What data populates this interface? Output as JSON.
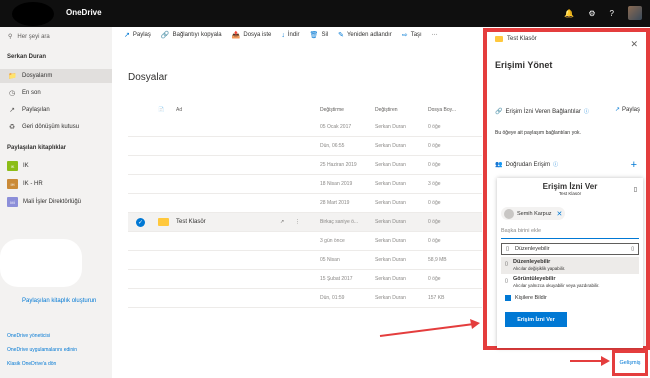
{
  "app": {
    "title": "OneDrive",
    "brand_color": "#0078d4",
    "highlight_color": "#e43d3d"
  },
  "topbar": {
    "icons": [
      "bell-icon",
      "gear-icon",
      "help-icon"
    ]
  },
  "nav": {
    "search_placeholder": "Her şeyi ara",
    "user_name": "Serkan Duran",
    "items": [
      {
        "label": "Dosyalarım",
        "icon": "folder-icon",
        "active": true
      },
      {
        "label": "En son",
        "icon": "clock-icon"
      },
      {
        "label": "Paylaşılan",
        "icon": "share-icon"
      },
      {
        "label": "Geri dönüşüm kutusu",
        "icon": "recycle-icon"
      }
    ],
    "shared_libs_heading": "Paylaşılan kitaplıklar",
    "libraries": [
      {
        "label": "IK",
        "color": "#8cbd18"
      },
      {
        "label": "IK - HR",
        "color": "#ca8a37"
      },
      {
        "label": "Mali İşler Direktörlüğü",
        "color": "#8c8fd9"
      }
    ],
    "create_library": "Paylaşılan kitaplık oluşturun",
    "footer": [
      "OneDrive yöneticisi",
      "OneDrive uygulamalarını edinin",
      "Klasik OneDrive'a dön"
    ]
  },
  "commands": [
    {
      "label": "Paylaş",
      "icon": "share-icon"
    },
    {
      "label": "Bağlantıyı kopyala",
      "icon": "link-icon"
    },
    {
      "label": "Dosya iste",
      "icon": "request-icon"
    },
    {
      "label": "İndir",
      "icon": "download-icon"
    },
    {
      "label": "Sil",
      "icon": "delete-icon"
    },
    {
      "label": "Yeniden adlandır",
      "icon": "rename-icon"
    },
    {
      "label": "Taşı",
      "icon": "move-icon"
    },
    {
      "label": "···",
      "icon": "more-icon"
    }
  ],
  "main": {
    "title": "Dosyalar",
    "columns": [
      "Ad",
      "Değiştirme",
      "Değiştiren",
      "Dosya Boy..."
    ],
    "rows": [
      {
        "name": "",
        "modified": "05 Ocak 2017",
        "by": "Serkan Duran",
        "size": "0 öğe"
      },
      {
        "name": "",
        "modified": "Dün, 06:55",
        "by": "Serkan Duran",
        "size": "0 öğe"
      },
      {
        "name": "",
        "modified": "25 Haziran 2019",
        "by": "Serkan Duran",
        "size": "0 öğe"
      },
      {
        "name": "",
        "modified": "18 Nisan 2019",
        "by": "Serkan Duran",
        "size": "3 öğe"
      },
      {
        "name": "",
        "modified": "28 Mart 2019",
        "by": "Serkan Duran",
        "size": "0 öğe"
      },
      {
        "name": "Test Klasör",
        "modified": "Birkaç saniye ö...",
        "by": "Serkan Duran",
        "size": "0 öğe",
        "selected": true
      },
      {
        "name": "",
        "modified": "3 gün önce",
        "by": "Serkan Duran",
        "size": "0 öğe"
      },
      {
        "name": "",
        "modified": "05 Nisan",
        "by": "Serkan Duran",
        "size": "58,9 MB"
      },
      {
        "name": "",
        "modified": "15 Şubat 2017",
        "by": "Serkan Duran",
        "size": "0 öğe"
      },
      {
        "name": "",
        "modified": "Dün, 01:59",
        "by": "Serkan Duran",
        "size": "157 KB"
      }
    ]
  },
  "panel": {
    "folder": "Test Klasör",
    "title": "Erişimi Yönet",
    "links_section": "Erişim İzni Veren Bağlantılar",
    "share_label": "Paylaş",
    "no_links_note": "Bu öğeye ait paylaşım bağlantıları yok.",
    "direct_access": "Doğrudan Erişim",
    "grant": {
      "title": "Erişim İzni Ver",
      "subtitle": "Test Klasör",
      "chip_name": "Semih Karpuz",
      "add_placeholder": "Başka birini ekle",
      "dropdown_value": "Düzenleyebilir",
      "options": [
        {
          "title": "Düzenleyebilir",
          "desc": "Alıcılar değişiklik yapabilir."
        },
        {
          "title": "Görüntüleyebilir",
          "desc": "Alıcılar yalnızca okuyabilir veya yazdırabilir."
        }
      ],
      "notify_label": "Kişilere Bildir",
      "button": "Erişim İzni Ver"
    },
    "advanced": "Gelişmiş"
  }
}
